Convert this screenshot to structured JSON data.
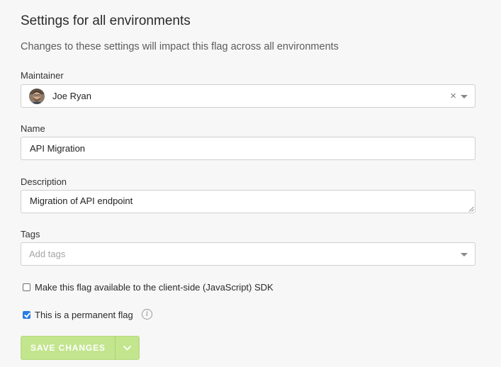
{
  "header": {
    "title": "Settings for all environments",
    "subtitle": "Changes to these settings will impact this flag across all environments"
  },
  "maintainer": {
    "label": "Maintainer",
    "value": "Joe Ryan",
    "clear_glyph": "×",
    "avatar_icon": "user-avatar"
  },
  "name": {
    "label": "Name",
    "value": "API Migration"
  },
  "description": {
    "label": "Description",
    "value": "Migration of API endpoint"
  },
  "tags": {
    "label": "Tags",
    "placeholder": "Add tags"
  },
  "client_side": {
    "label": "Make this flag available to the client-side (JavaScript) SDK",
    "checked": false
  },
  "permanent": {
    "label": "This is a permanent flag",
    "checked": true,
    "info_glyph": "i"
  },
  "actions": {
    "save_label": "SAVE CHANGES",
    "dropdown_icon": "chevron-down-icon"
  },
  "colors": {
    "save_button_bg": "#c2e58e",
    "checkbox_checked": "#2a7de1"
  }
}
